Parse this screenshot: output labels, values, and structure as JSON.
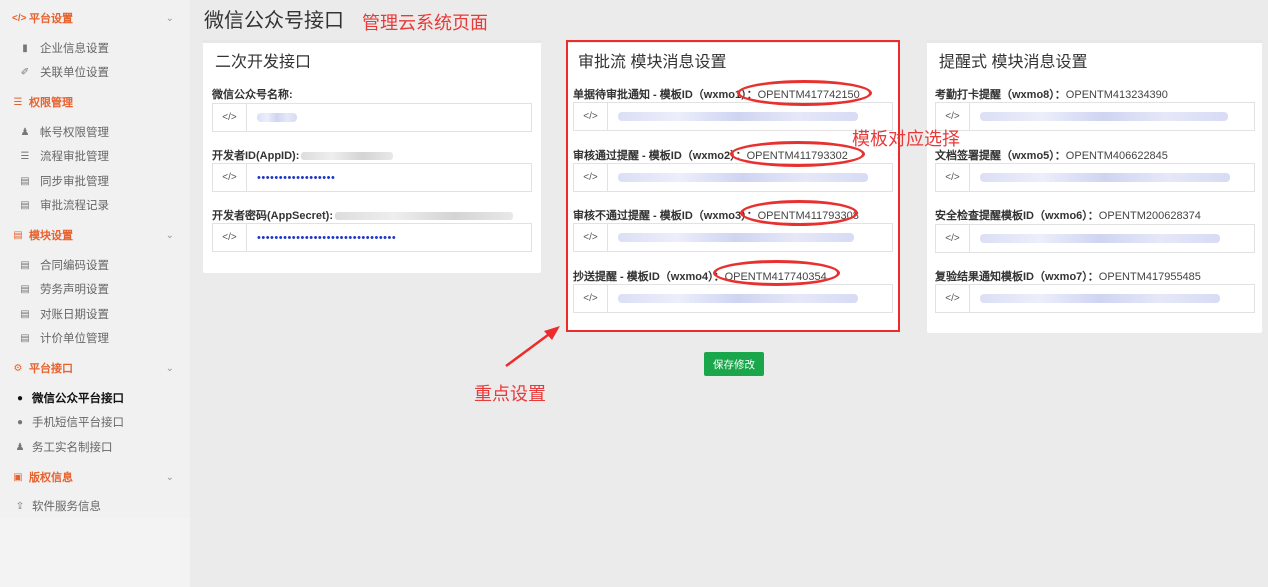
{
  "sidebar": {
    "groups": [
      {
        "label": "平台设置",
        "icon": "code-icon"
      },
      {
        "label": "权限管理",
        "icon": "list-icon"
      },
      {
        "label": "模块设置",
        "icon": "doc-icon"
      },
      {
        "label": "平台接口",
        "icon": "gear-icon"
      },
      {
        "label": "版权信息",
        "icon": "info-icon"
      }
    ],
    "items": {
      "g1": [
        "企业信息设置",
        "关联单位设置"
      ],
      "g2": [
        "帐号权限管理",
        "流程审批管理",
        "同步审批管理",
        "审批流程记录"
      ],
      "g3": [
        "合同编码设置",
        "劳务声明设置",
        "对账日期设置",
        "计价单位管理"
      ],
      "g4": [
        "微信公众平台接口",
        "手机短信平台接口",
        "务工实名制接口"
      ],
      "g5": [
        "软件服务信息"
      ]
    }
  },
  "page": {
    "title": "微信公众号接口",
    "annotation_title": "管理云系统页面",
    "annotation_template": "模板对应选择",
    "annotation_key": "重点设置"
  },
  "panel1": {
    "title": "二次开发接口",
    "fields": [
      {
        "label": "微信公众号名称:"
      },
      {
        "label": "开发者ID(AppID):",
        "value": "••••••••••••••••••"
      },
      {
        "label": "开发者密码(AppSecret):",
        "value": "••••••••••••••••••••••••••••••••"
      }
    ]
  },
  "panel2": {
    "title": "审批流 模块消息设置",
    "fields": [
      {
        "label": "单据待审批通知 - 模板ID（wxmo1）：",
        "tid": "OPENTM417742150"
      },
      {
        "label": "审核通过提醒 - 模板ID（wxmo2）：",
        "tid": "OPENTM411793302"
      },
      {
        "label": "审核不通过提醒 - 模板ID（wxmo3）：",
        "tid": "OPENTM411793308"
      },
      {
        "label": "抄送提醒 - 模板ID（wxmo4）：",
        "tid": "OPENTM417740354"
      }
    ]
  },
  "panel3": {
    "title": "提醒式 模块消息设置",
    "fields": [
      {
        "label": "考勤打卡提醒（wxmo8）：",
        "tid": "OPENTM413234390"
      },
      {
        "label": "文档签署提醒（wxmo5）：",
        "tid": "OPENTM406622845"
      },
      {
        "label": "安全检查提醒模板ID（wxmo6）：",
        "tid": "OPENTM200628374"
      },
      {
        "label": "复验结果通知模板ID（wxmo7）：",
        "tid": "OPENTM417955485"
      }
    ]
  },
  "addon_icon": "</>",
  "save_button": "保存修改",
  "colors": {
    "accent": "#e8622e",
    "annotation": "#e93a3a",
    "save": "#1aa64a",
    "masked": "#1e37c8"
  }
}
